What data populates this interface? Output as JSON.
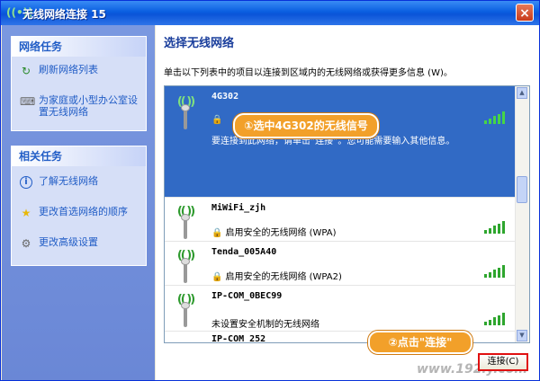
{
  "window": {
    "title": "无线网络连接 15",
    "close_label": "×"
  },
  "left_pane": {
    "network_tasks": {
      "heading": "网络任务",
      "items": [
        {
          "icon": "refresh-icon",
          "label": "刷新网络列表"
        },
        {
          "icon": "wireless-setup-icon",
          "label": "为家庭或小型办公室设置无线网络"
        }
      ]
    },
    "related_tasks": {
      "heading": "相关任务",
      "items": [
        {
          "icon": "info-icon",
          "label": "了解无线网络"
        },
        {
          "icon": "star-icon",
          "label": "更改首选网络的顺序"
        },
        {
          "icon": "settings-icon",
          "label": "更改高级设置"
        }
      ]
    }
  },
  "main": {
    "heading": "选择无线网络",
    "instructions": "单击以下列表中的项目以连接到区域内的无线网络或获得更多信息 (W)。",
    "networks": [
      {
        "ssid": "4G302",
        "status": "",
        "info": "要连接到此网络，请单击“连接”。您可能需要输入其他信息。",
        "secured": true,
        "selected": true
      },
      {
        "ssid": "MiWiFi_zjh",
        "status": "启用安全的无线网络 (WPA)",
        "secured": true,
        "selected": false
      },
      {
        "ssid": "Tenda_005A40",
        "status": "启用安全的无线网络 (WPA2)",
        "secured": true,
        "selected": false
      },
      {
        "ssid": "IP-COM_0BEC99",
        "status": "未设置安全机制的无线网络",
        "secured": false,
        "selected": false
      },
      {
        "ssid": "IP-COM_252",
        "status": "",
        "secured": false,
        "selected": false
      }
    ],
    "connect_label": "连接(C)"
  },
  "annotations": {
    "step1": "①选中4G302的无线信号",
    "step2": "②点击\"连接\""
  },
  "watermark": "www.192ly.com",
  "colors": {
    "title_bar": "#0a5ee0",
    "selection": "#316ac5",
    "callout": "#f2a02a",
    "highlight_border": "#e01010"
  }
}
